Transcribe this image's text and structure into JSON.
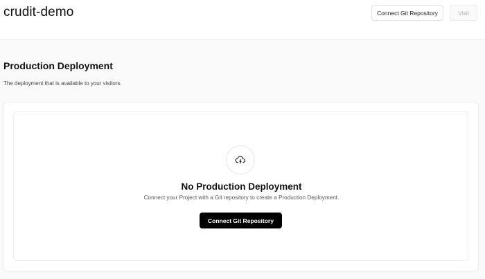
{
  "header": {
    "project_name": "crudit-demo",
    "connect_button_label": "Connect Git Repository",
    "visit_button_label": "Visit"
  },
  "production": {
    "title": "Production Deployment",
    "description": "The deployment that is available to your visitors.",
    "empty_state": {
      "icon": "cloud-lightning-icon",
      "title": "No Production Deployment",
      "description": "Connect your Project with a Git repository to create a Production Deployment.",
      "button_label": "Connect Git Repository"
    }
  },
  "colors": {
    "primary_button_bg": "#000000",
    "primary_button_text": "#ffffff",
    "page_bg": "#fafafa",
    "card_bg": "#ffffff"
  }
}
